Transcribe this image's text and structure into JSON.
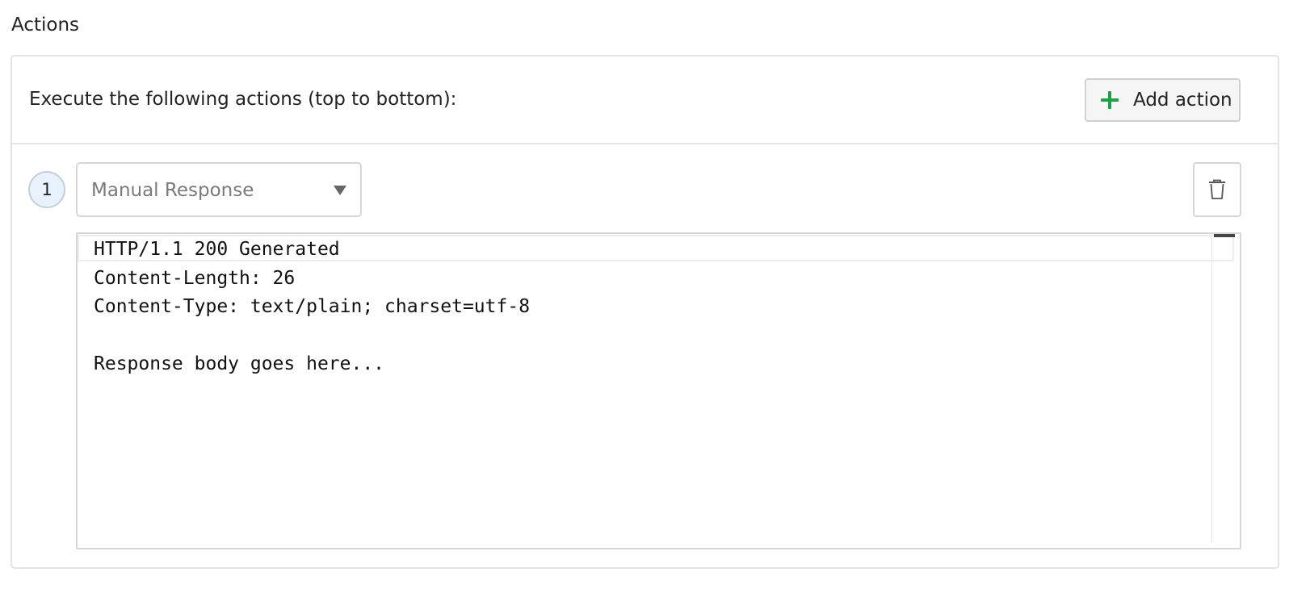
{
  "section": {
    "title": "Actions"
  },
  "panel": {
    "instructions": "Execute the following actions (top to bottom):",
    "add_action_label": "Add action",
    "accent_color": "#1aa14a"
  },
  "action": {
    "step_number": "1",
    "type_selected": "Manual Response",
    "delete_icon": "trash-icon"
  },
  "editor": {
    "lines": [
      "HTTP/1.1 200 Generated",
      "Content-Length: 26",
      "Content-Type: text/plain; charset=utf-8",
      "",
      "Response body goes here..."
    ]
  }
}
